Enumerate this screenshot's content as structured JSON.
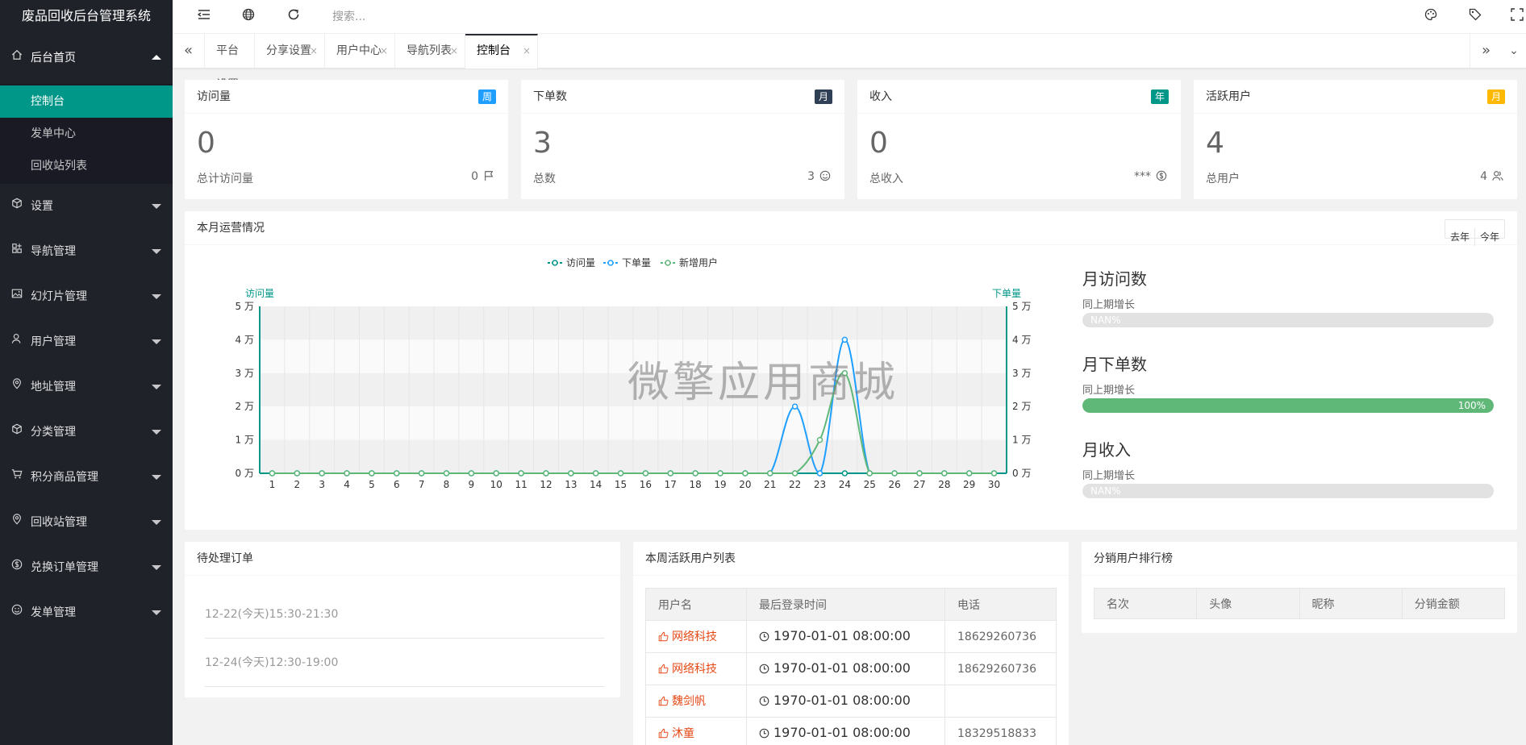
{
  "app": {
    "title": "废品回收后台管理系统"
  },
  "sidebar": {
    "items": [
      {
        "label": "后台首页",
        "icon": "home-icon",
        "open": true,
        "children": [
          {
            "label": "控制台",
            "active": true
          },
          {
            "label": "发单中心"
          },
          {
            "label": "回收站列表"
          }
        ]
      },
      {
        "label": "设置",
        "icon": "cube-icon"
      },
      {
        "label": "导航管理",
        "icon": "apps-icon"
      },
      {
        "label": "幻灯片管理",
        "icon": "image-icon"
      },
      {
        "label": "用户管理",
        "icon": "user-icon"
      },
      {
        "label": "地址管理",
        "icon": "location-icon"
      },
      {
        "label": "分类管理",
        "icon": "cube-icon"
      },
      {
        "label": "积分商品管理",
        "icon": "cart-icon"
      },
      {
        "label": "回收站管理",
        "icon": "location-icon"
      },
      {
        "label": "兑换订单管理",
        "icon": "dollar-icon"
      },
      {
        "label": "发单管理",
        "icon": "smile-icon"
      }
    ]
  },
  "header": {
    "search_placeholder": "搜索..."
  },
  "tabs": {
    "items": [
      {
        "label": "平台设置",
        "closable": false
      },
      {
        "label": "分享设置",
        "closable": true
      },
      {
        "label": "用户中心",
        "closable": true
      },
      {
        "label": "导航列表",
        "closable": true
      },
      {
        "label": "控制台",
        "closable": true,
        "active": true
      }
    ],
    "close_glyph": "×"
  },
  "stats": [
    {
      "title": "访问量",
      "badge": "周",
      "badge_color": "#1e9fff",
      "value": "0",
      "label": "总计访问量",
      "right": "0",
      "icon": "flag-icon"
    },
    {
      "title": "下单数",
      "badge": "月",
      "badge_color": "#2f4056",
      "value": "3",
      "label": "总数",
      "right": "3",
      "icon": "smile-icon"
    },
    {
      "title": "收入",
      "badge": "年",
      "badge_color": "#009688",
      "value": "0",
      "label": "总收入",
      "right": "***",
      "icon": "dollar-icon"
    },
    {
      "title": "活跃用户",
      "badge": "月",
      "badge_color": "#ffb800",
      "value": "4",
      "label": "总用户",
      "right": "4",
      "icon": "users-icon"
    }
  ],
  "operations": {
    "title": "本月运营情况",
    "btn_last_year": "去年",
    "btn_this_year": "今年",
    "watermark": "微擎应用商城",
    "kpis": [
      {
        "title": "月访问数",
        "sub": "同上期增长",
        "progress_label": "NAN%",
        "progress": 0,
        "color": "#e2e2e2",
        "label_color": "#ffffff"
      },
      {
        "title": "月下单数",
        "sub": "同上期增长",
        "progress_label": "100%",
        "progress": 1.0,
        "color": "#5fb878",
        "label_color": "#ffffff"
      },
      {
        "title": "月收入",
        "sub": "同上期增长",
        "progress_label": "NAN%",
        "progress": 0,
        "color": "#e2e2e2",
        "label_color": "#ffffff"
      }
    ]
  },
  "chart_data": {
    "type": "line",
    "title": "",
    "ylabel_left": "访问量",
    "ylabel_right": "下单量",
    "ylim": [
      0,
      50000
    ],
    "y_ticks": [
      "0 万",
      "1 万",
      "2 万",
      "3 万",
      "4 万",
      "5 万"
    ],
    "x": [
      "1",
      "2",
      "3",
      "4",
      "5",
      "6",
      "7",
      "8",
      "9",
      "10",
      "11",
      "12",
      "13",
      "14",
      "15",
      "16",
      "17",
      "18",
      "19",
      "20",
      "21",
      "22",
      "23",
      "24",
      "25",
      "26",
      "27",
      "28",
      "29",
      "30"
    ],
    "grid": true,
    "legend_position": "top-center",
    "series": [
      {
        "name": "访问量",
        "color": "#009688",
        "values": [
          0,
          0,
          0,
          0,
          0,
          0,
          0,
          0,
          0,
          0,
          0,
          0,
          0,
          0,
          0,
          0,
          0,
          0,
          0,
          0,
          0,
          0,
          0,
          0,
          0,
          0,
          0,
          0,
          0,
          0
        ]
      },
      {
        "name": "下单量",
        "color": "#1e9fff",
        "values": [
          0,
          0,
          0,
          0,
          0,
          0,
          0,
          0,
          0,
          0,
          0,
          0,
          0,
          0,
          0,
          0,
          0,
          0,
          0,
          0,
          0,
          20000,
          0,
          40000,
          0,
          0,
          0,
          0,
          0,
          0
        ]
      },
      {
        "name": "新增用户",
        "color": "#5fb878",
        "values": [
          0,
          0,
          0,
          0,
          0,
          0,
          0,
          0,
          0,
          0,
          0,
          0,
          0,
          0,
          0,
          0,
          0,
          0,
          0,
          0,
          0,
          0,
          10000,
          30000,
          0,
          0,
          0,
          0,
          0,
          0
        ]
      }
    ]
  },
  "pending_orders": {
    "title": "待处理订单",
    "items": [
      "12-22(今天)15:30-21:30",
      "12-24(今天)12:30-19:00"
    ]
  },
  "active_users": {
    "title": "本周活跃用户列表",
    "columns": [
      "用户名",
      "最后登录时间",
      "电话"
    ],
    "rows": [
      {
        "name": "网络科技",
        "time": "1970-01-01 08:00:00",
        "phone": "18629260736"
      },
      {
        "name": "网络科技",
        "time": "1970-01-01 08:00:00",
        "phone": "18629260736"
      },
      {
        "name": "魏剑帆",
        "time": "1970-01-01 08:00:00",
        "phone": ""
      },
      {
        "name": "沐童",
        "time": "1970-01-01 08:00:00",
        "phone": "18329518833"
      }
    ]
  },
  "distribution": {
    "title": "分销用户排行榜",
    "columns": [
      "名次",
      "头像",
      "昵称",
      "分销金额"
    ]
  }
}
